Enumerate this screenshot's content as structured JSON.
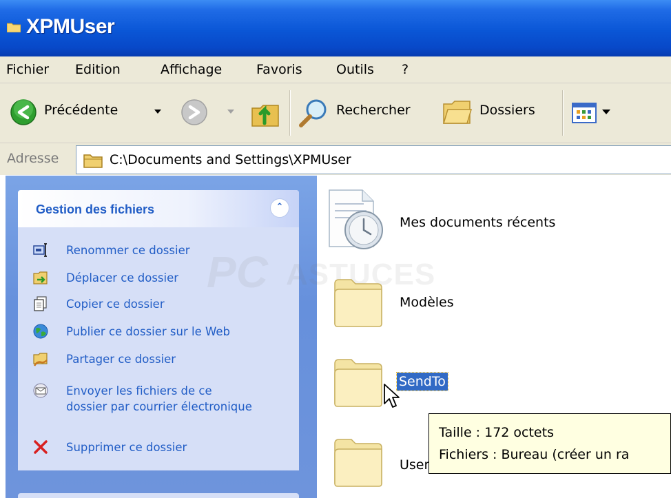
{
  "window": {
    "title": "XPMUser"
  },
  "menu": [
    "Fichier",
    "Edition",
    "Affichage",
    "Favoris",
    "Outils",
    "?"
  ],
  "toolbar": {
    "back_label": "Précédente",
    "search_label": "Rechercher",
    "folders_label": "Dossiers"
  },
  "address": {
    "label": "Adresse",
    "path": "C:\\Documents and Settings\\XPMUser"
  },
  "tasks_panel": {
    "title": "Gestion des fichiers",
    "items": [
      {
        "label": "Renommer ce dossier",
        "icon": "rename-icon"
      },
      {
        "label": "Déplacer ce dossier",
        "icon": "move-icon"
      },
      {
        "label": "Copier ce dossier",
        "icon": "copy-icon"
      },
      {
        "label": "Publier ce dossier sur le Web",
        "icon": "publish-web-icon"
      },
      {
        "label": "Partager ce dossier",
        "icon": "share-icon"
      },
      {
        "label": "Envoyer les fichiers de ce dossier par courrier électronique",
        "icon": "email-icon"
      },
      {
        "label": "Supprimer ce dossier",
        "icon": "delete-icon"
      }
    ]
  },
  "files": [
    {
      "name": "Mes documents récents",
      "icon": "recent-documents-icon"
    },
    {
      "name": "Modèles",
      "icon": "folder-icon"
    },
    {
      "name": "SendTo",
      "icon": "folder-icon",
      "selected": true
    },
    {
      "name": "User",
      "icon": "folder-icon"
    }
  ],
  "tooltip": {
    "line1": "Taille : 172 octets",
    "line2": "Fichiers : Bureau (créer un ra"
  },
  "watermark": {
    "part1": "PC",
    "part2": "ASTUCES"
  },
  "colors": {
    "titlebar": "#0a56d6",
    "link": "#215dc6",
    "selection": "#316ac5",
    "tooltip_bg": "#ffffe1",
    "taskpane_bg": "#6e94dc"
  }
}
